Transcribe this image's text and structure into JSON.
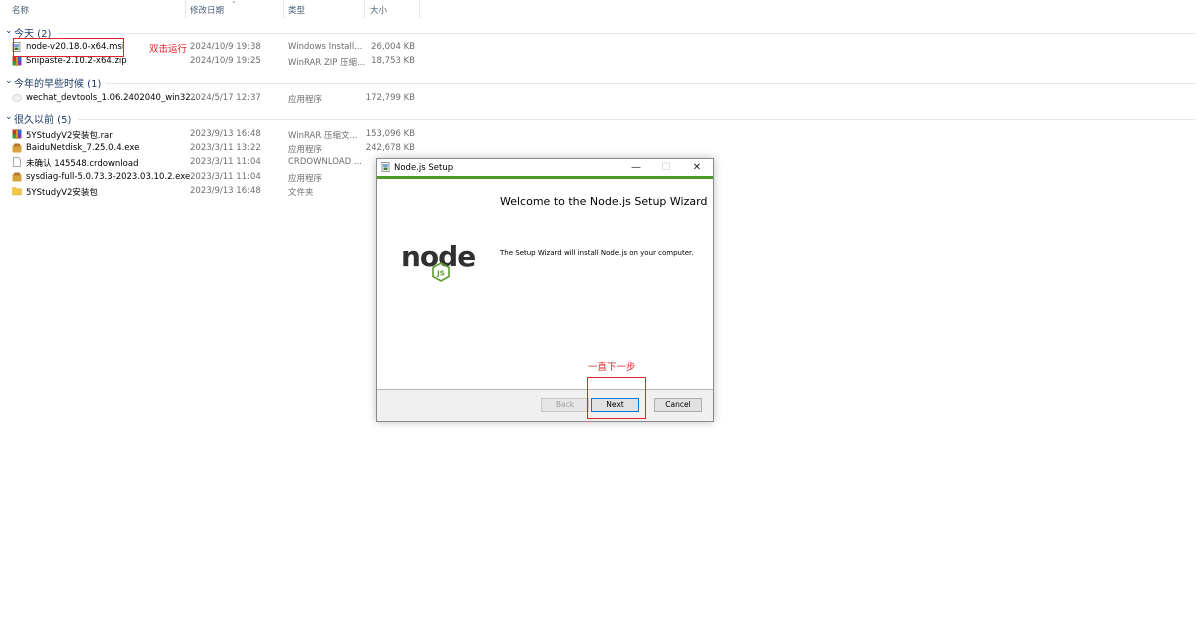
{
  "columns": {
    "name": "名称",
    "modified": "修改日期",
    "type": "类型",
    "size": "大小"
  },
  "groups": [
    {
      "title": "今天 (2)",
      "rows": [
        {
          "name": "node-v20.18.0-x64.msi",
          "date": "2024/10/9 19:38",
          "type": "Windows Install...",
          "size": "26,004 KB",
          "icon": "msi-installer-icon"
        },
        {
          "name": "Snipaste-2.10.2-x64.zip",
          "date": "2024/10/9 19:25",
          "type": "WinRAR ZIP 压缩...",
          "size": "18,753 KB",
          "icon": "winrar-archive-icon"
        }
      ]
    },
    {
      "title": "今年的早些时候 (1)",
      "rows": [
        {
          "name": "wechat_devtools_1.06.2402040_win32...",
          "date": "2024/5/17 12:37",
          "type": "应用程序",
          "size": "172,799 KB",
          "icon": "application-icon"
        }
      ]
    },
    {
      "title": "很久以前 (5)",
      "rows": [
        {
          "name": "5YStudyV2安装包.rar",
          "date": "2023/9/13 16:48",
          "type": "WinRAR 压缩文...",
          "size": "153,096 KB",
          "icon": "winrar-archive-icon"
        },
        {
          "name": "BaiduNetdisk_7.25.0.4.exe",
          "date": "2023/3/11 13:22",
          "type": "应用程序",
          "size": "242,678 KB",
          "icon": "installer-exe-icon"
        },
        {
          "name": "未确认 145548.crdownload",
          "date": "2023/3/11 11:04",
          "type": "CRDOWNLOAD ...",
          "size": "",
          "icon": "blank-file-icon"
        },
        {
          "name": "sysdiag-full-5.0.73.3-2023.03.10.2.exe",
          "date": "2023/3/11 11:04",
          "type": "应用程序",
          "size": "",
          "icon": "installer-exe-icon"
        },
        {
          "name": "5YStudyV2安装包",
          "date": "2023/9/13 16:48",
          "type": "文件夹",
          "size": "",
          "icon": "folder-icon"
        }
      ]
    }
  ],
  "annotations": {
    "double_click": "双击运行",
    "keep_next": "一直下一步"
  },
  "dialog": {
    "title": "Node.js Setup",
    "heading": "Welcome to the Node.js Setup Wizard",
    "description": "The Setup Wizard will install Node.js on your computer.",
    "logo_text": "node",
    "logo_badge": "JS",
    "minimize": "—",
    "maximize": "☐",
    "close": "✕",
    "buttons": {
      "back": "Back",
      "next": "Next",
      "cancel": "Cancel"
    },
    "accent_color": "#4c9a2a"
  },
  "colors": {
    "annotation_red": "#e0242b",
    "group_header": "#1e3a66"
  }
}
